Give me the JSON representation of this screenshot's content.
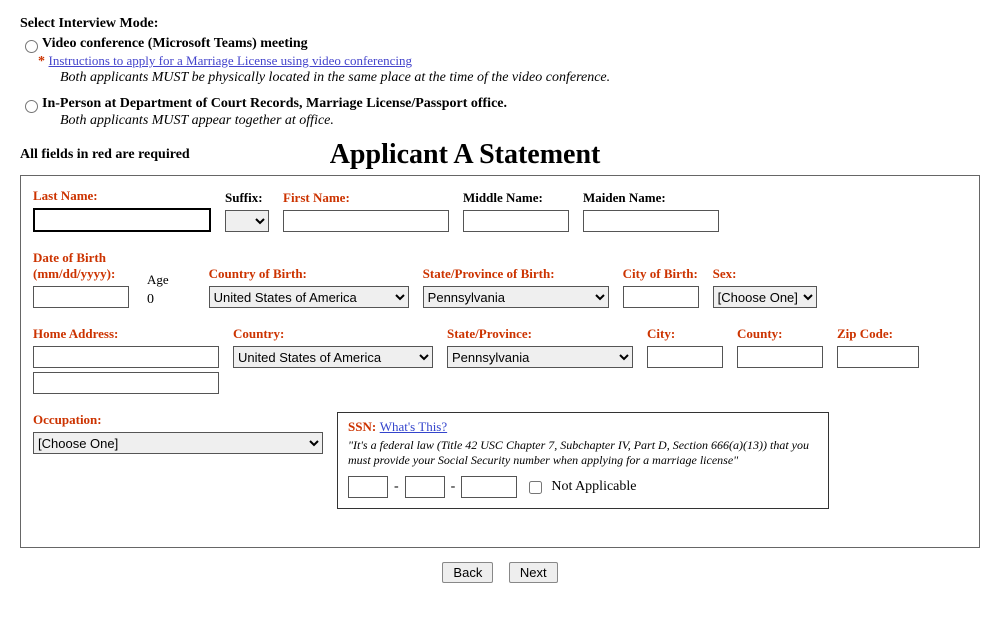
{
  "interview": {
    "heading": "Select Interview Mode:",
    "option1": {
      "label": "Video conference (Microsoft Teams) meeting",
      "link_prefix": "*",
      "link": "Instructions to apply for a Marriage License using video conferencing",
      "note": "Both applicants MUST be physically located in the same place at the time of the video conference."
    },
    "option2": {
      "label": "In-Person at Department of Court Records, Marriage License/Passport office.",
      "note": "Both applicants MUST appear together at office."
    }
  },
  "required_note": "All fields in red are required",
  "form_title": "Applicant A Statement",
  "labels": {
    "last_name": "Last Name:",
    "suffix": "Suffix:",
    "first_name": "First Name:",
    "middle_name": "Middle Name:",
    "maiden_name": "Maiden Name:",
    "dob": "Date of Birth (mm/dd/yyyy):",
    "age": "Age",
    "age_value": "0",
    "country_birth": "Country of Birth:",
    "state_birth": "State/Province of Birth:",
    "city_birth": "City of Birth:",
    "sex": "Sex:",
    "home_address": "Home Address:",
    "country": "Country:",
    "state": "State/Province:",
    "city": "City:",
    "county": "County:",
    "zip": "Zip Code:",
    "occupation": "Occupation:"
  },
  "values": {
    "country_birth": "United States of America",
    "state_birth": "Pennsylvania",
    "sex": "[Choose One]",
    "country": "United States of America",
    "state": "Pennsylvania",
    "occupation": "[Choose One]"
  },
  "ssn": {
    "title": "SSN:",
    "whats_this": "What's This?",
    "note": "\"It's a federal law (Title 42 USC Chapter 7, Subchapter IV, Part D, Section 666(a)(13)) that you must provide your Social Security number when applying for a marriage license\"",
    "na_label": "Not Applicable"
  },
  "buttons": {
    "back": "Back",
    "next": "Next"
  }
}
